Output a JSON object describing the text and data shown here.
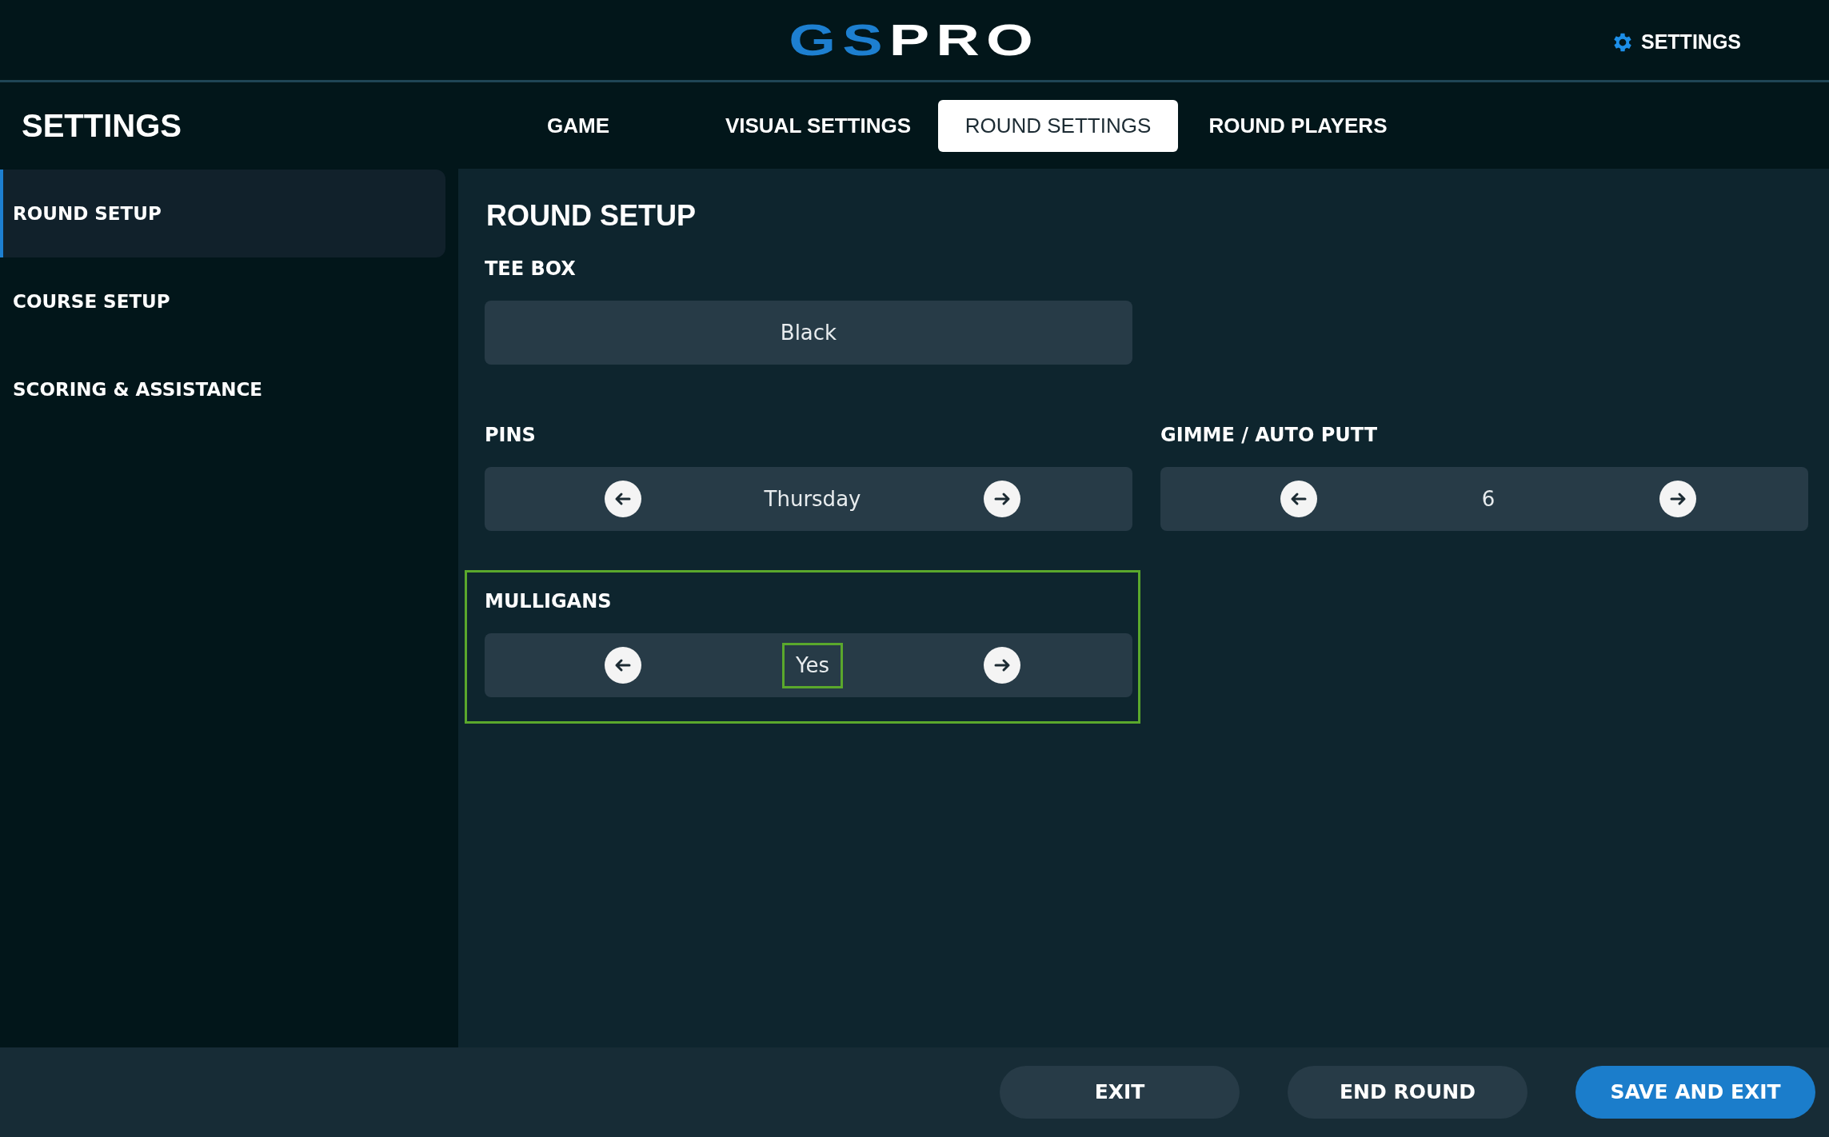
{
  "header": {
    "logo": {
      "part_1": "GS",
      "part_2": "PRO"
    },
    "settings_link": "SETTINGS"
  },
  "page_title": "SETTINGS",
  "tabs": [
    {
      "label": "GAME",
      "selected": false
    },
    {
      "label": "VISUAL SETTINGS",
      "selected": false
    },
    {
      "label": "ROUND SETTINGS",
      "selected": true
    },
    {
      "label": "ROUND PLAYERS",
      "selected": false
    }
  ],
  "sidebar": {
    "items": [
      {
        "label": "ROUND SETUP",
        "selected": true
      },
      {
        "label": "COURSE SETUP",
        "selected": false
      },
      {
        "label": "SCORING & ASSISTANCE",
        "selected": false
      }
    ]
  },
  "section_title": "ROUND SETUP",
  "rows": [
    [
      {
        "kind": "select",
        "label": "TEE BOX",
        "value": "Black",
        "focused": false
      }
    ],
    [
      {
        "kind": "stepper",
        "label": "PINS",
        "value": "Thursday",
        "focused": false
      },
      {
        "kind": "stepper",
        "label": "GIMME / AUTO PUTT",
        "value": "6",
        "focused": false
      }
    ],
    [
      {
        "kind": "stepper",
        "label": "MULLIGANS",
        "value": "Yes",
        "focused": true
      }
    ]
  ],
  "footer_buttons": [
    {
      "label": "EXIT",
      "kind": "secondary"
    },
    {
      "label": "END ROUND",
      "kind": "secondary"
    },
    {
      "label": "SAVE AND EXIT",
      "kind": "primary"
    }
  ]
}
